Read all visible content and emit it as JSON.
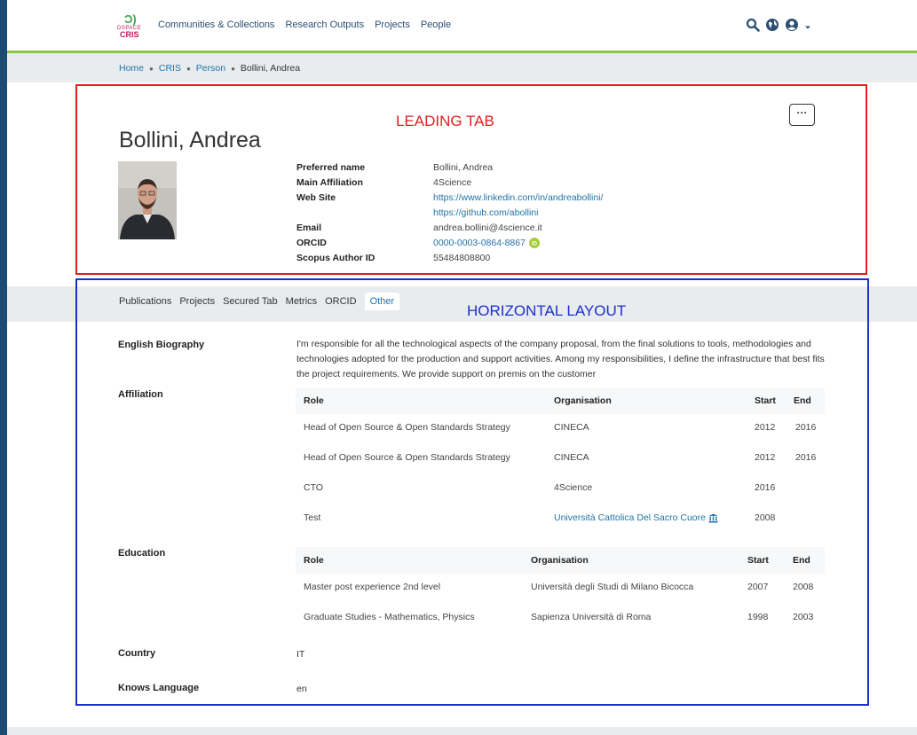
{
  "logo": {
    "mark": "Ͻ)",
    "line1": "DSPACE",
    "line2": "CRIS"
  },
  "nav": {
    "items": [
      "Communities & Collections",
      "Research Outputs",
      "Projects",
      "People"
    ],
    "icons": [
      "search-icon",
      "globe-icon",
      "user-icon",
      "caret-down-icon"
    ]
  },
  "breadcrumb": [
    "Home",
    "CRIS",
    "Person",
    "Bollini, Andrea"
  ],
  "annotations": {
    "leading": "LEADING TAB",
    "horizontal": "HORIZONTAL LAYOUT"
  },
  "person": {
    "name": "Bollini, Andrea",
    "more_button": "···",
    "fields": {
      "preferred_name": {
        "label": "Preferred name",
        "value": "Bollini, Andrea"
      },
      "main_affiliation": {
        "label": "Main Affiliation",
        "value": "4Science"
      },
      "web_site": {
        "label": "Web Site",
        "values": [
          "https://www.linkedin.com/in/andreabollini/",
          "https://github.com/abollini"
        ]
      },
      "email": {
        "label": "Email",
        "value": "andrea.bollini@4science.it"
      },
      "orcid": {
        "label": "ORCID",
        "value": "0000-0003-0864-8867"
      },
      "scopus": {
        "label": "Scopus Author ID",
        "value": "55484808800"
      }
    }
  },
  "tabs": [
    {
      "label": "Publications",
      "active": false
    },
    {
      "label": "Projects",
      "active": false
    },
    {
      "label": "Secured Tab",
      "active": false
    },
    {
      "label": "Metrics",
      "active": false
    },
    {
      "label": "ORCID",
      "active": false
    },
    {
      "label": "Other",
      "active": true
    }
  ],
  "details": {
    "english_biography": {
      "label": "English Biography",
      "text": "I'm responsible for all the technological aspects of the company proposal, from the final solutions to tools, methodologies and technologies adopted for the production and support activities. Among my responsibilities, I define the infrastructure that best fits the project requirements. We provide support on premis on the customer"
    },
    "affiliation": {
      "label": "Affiliation",
      "headers": [
        "Role",
        "Organisation",
        "Start",
        "End"
      ],
      "rows": [
        [
          "Head of Open Source & Open Standards Strategy",
          "CINECA",
          "2012",
          "2016"
        ],
        [
          "Head of Open Source & Open Standards Strategy",
          "CINECA",
          "2012",
          "2016"
        ],
        [
          "CTO",
          "4Science",
          "2016",
          ""
        ],
        [
          "Test",
          "Università Cattolica Del Sacro Cuore",
          "2008",
          ""
        ]
      ]
    },
    "education": {
      "label": "Education",
      "headers": [
        "Role",
        "Organisation",
        "Start",
        "End"
      ],
      "rows": [
        [
          "Master post experience 2nd level",
          "Università degli Studi di Milano Bicocca",
          "2007",
          "2008"
        ],
        [
          "Graduate Studies - Mathematics, Physics",
          "Sapienza Università di Roma",
          "1998",
          "2003"
        ]
      ]
    },
    "country": {
      "label": "Country",
      "value": "IT"
    },
    "knows_language": {
      "label": "Knows Language",
      "value": "en"
    }
  },
  "colors": {
    "link": "#1e73a8",
    "accent_green": "#8dc63f",
    "annotation_red": "#e02020",
    "annotation_blue": "#1a2fcf",
    "orcid_green": "#a6ce39"
  }
}
